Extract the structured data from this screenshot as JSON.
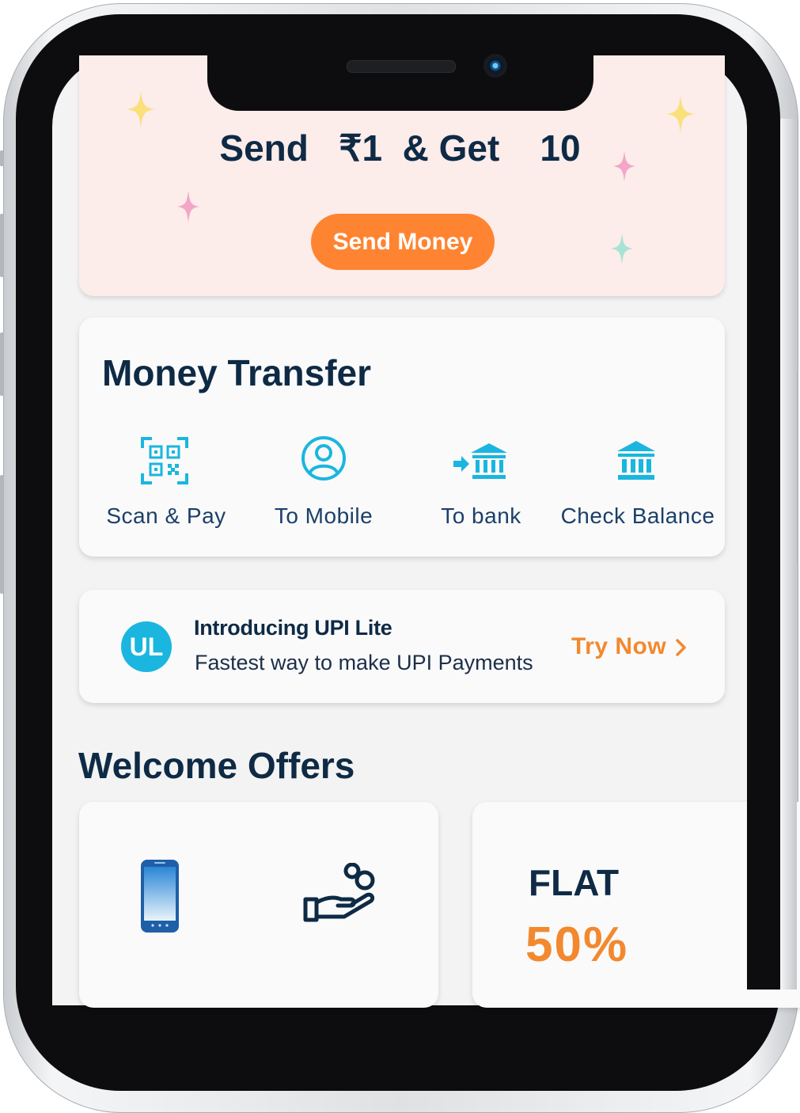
{
  "banner": {
    "title": "Send   ₹1  & Get    10",
    "button_label": "Send Money"
  },
  "money_transfer": {
    "title": "Money Transfer",
    "items": [
      {
        "label": "Scan & Pay",
        "icon": "qr-scan-icon"
      },
      {
        "label": "To Mobile",
        "icon": "user-circle-icon"
      },
      {
        "label": "To bank",
        "icon": "bank-transfer-icon"
      },
      {
        "label": "Check Balance",
        "icon": "bank-icon"
      }
    ]
  },
  "upi_lite": {
    "badge": "UL",
    "title": "Introducing UPI Lite",
    "subtitle": "Fastest way to make UPI Payments",
    "cta": "Try Now"
  },
  "welcome_offers": {
    "title": "Welcome Offers",
    "cards": [
      {
        "icons": [
          "mobile-phone-icon",
          "hand-coins-icon"
        ]
      },
      {
        "line1": "FLAT",
        "line2": "50%"
      }
    ]
  },
  "colors": {
    "navy": "#0e2a45",
    "orange": "#ff8431",
    "cyan": "#1ab6df",
    "banner_bg": "#fcecea"
  }
}
